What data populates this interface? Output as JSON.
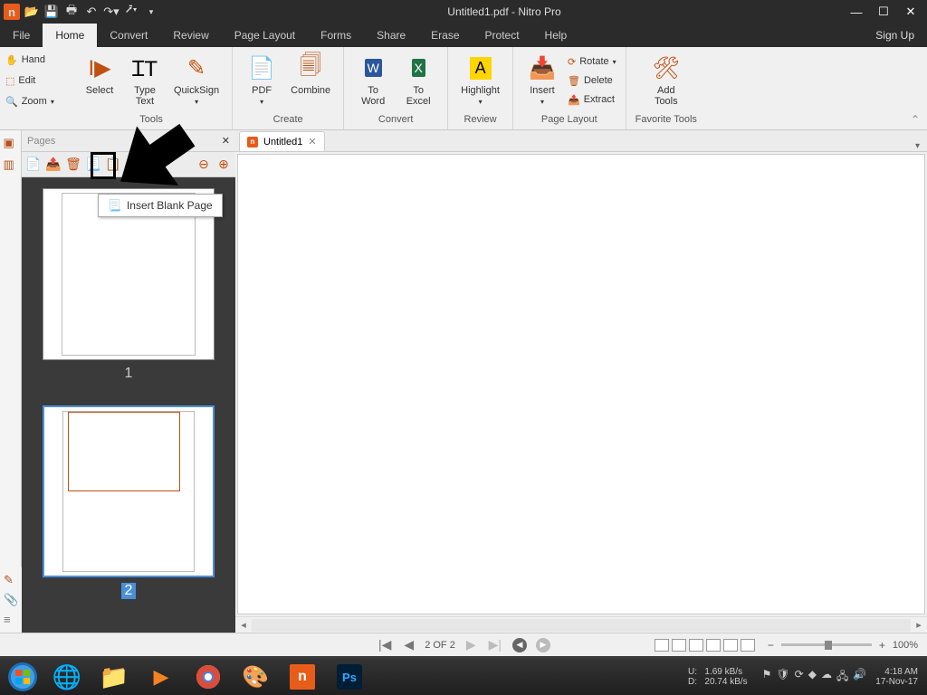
{
  "titlebar": {
    "title": "Untitled1.pdf - Nitro Pro"
  },
  "menu": {
    "file": "File",
    "home": "Home",
    "convert": "Convert",
    "review": "Review",
    "pagelayout": "Page Layout",
    "forms": "Forms",
    "share": "Share",
    "erase": "Erase",
    "protect": "Protect",
    "help": "Help",
    "signup": "Sign Up"
  },
  "sidetools": {
    "hand": "Hand",
    "edit": "Edit",
    "zoom": "Zoom"
  },
  "ribbon": {
    "select": "Select",
    "typetext": "Type\nText",
    "quicksign": "QuickSign",
    "tools_label": "Tools",
    "pdf": "PDF",
    "combine": "Combine",
    "create_label": "Create",
    "toword": "To\nWord",
    "toexcel": "To\nExcel",
    "convert_label": "Convert",
    "highlight": "Highlight",
    "review_label": "Review",
    "insert": "Insert",
    "rotate": "Rotate",
    "delete": "Delete",
    "extract": "Extract",
    "pl_label": "Page Layout",
    "addtools": "Add\nTools",
    "fav_label": "Favorite Tools"
  },
  "pages": {
    "header": "Pages",
    "p1": "1",
    "p2": "2"
  },
  "tooltip": {
    "text": "Insert Blank Page"
  },
  "doctab": {
    "name": "Untitled1"
  },
  "status": {
    "pages": "2 OF 2",
    "zoom": "100%"
  },
  "taskbar": {
    "u": "U:",
    "d": "D:",
    "u_val": "1.69 kB/s",
    "d_val": "20.74 kB/s",
    "time": "4:18 AM",
    "date": "17-Nov-17"
  }
}
